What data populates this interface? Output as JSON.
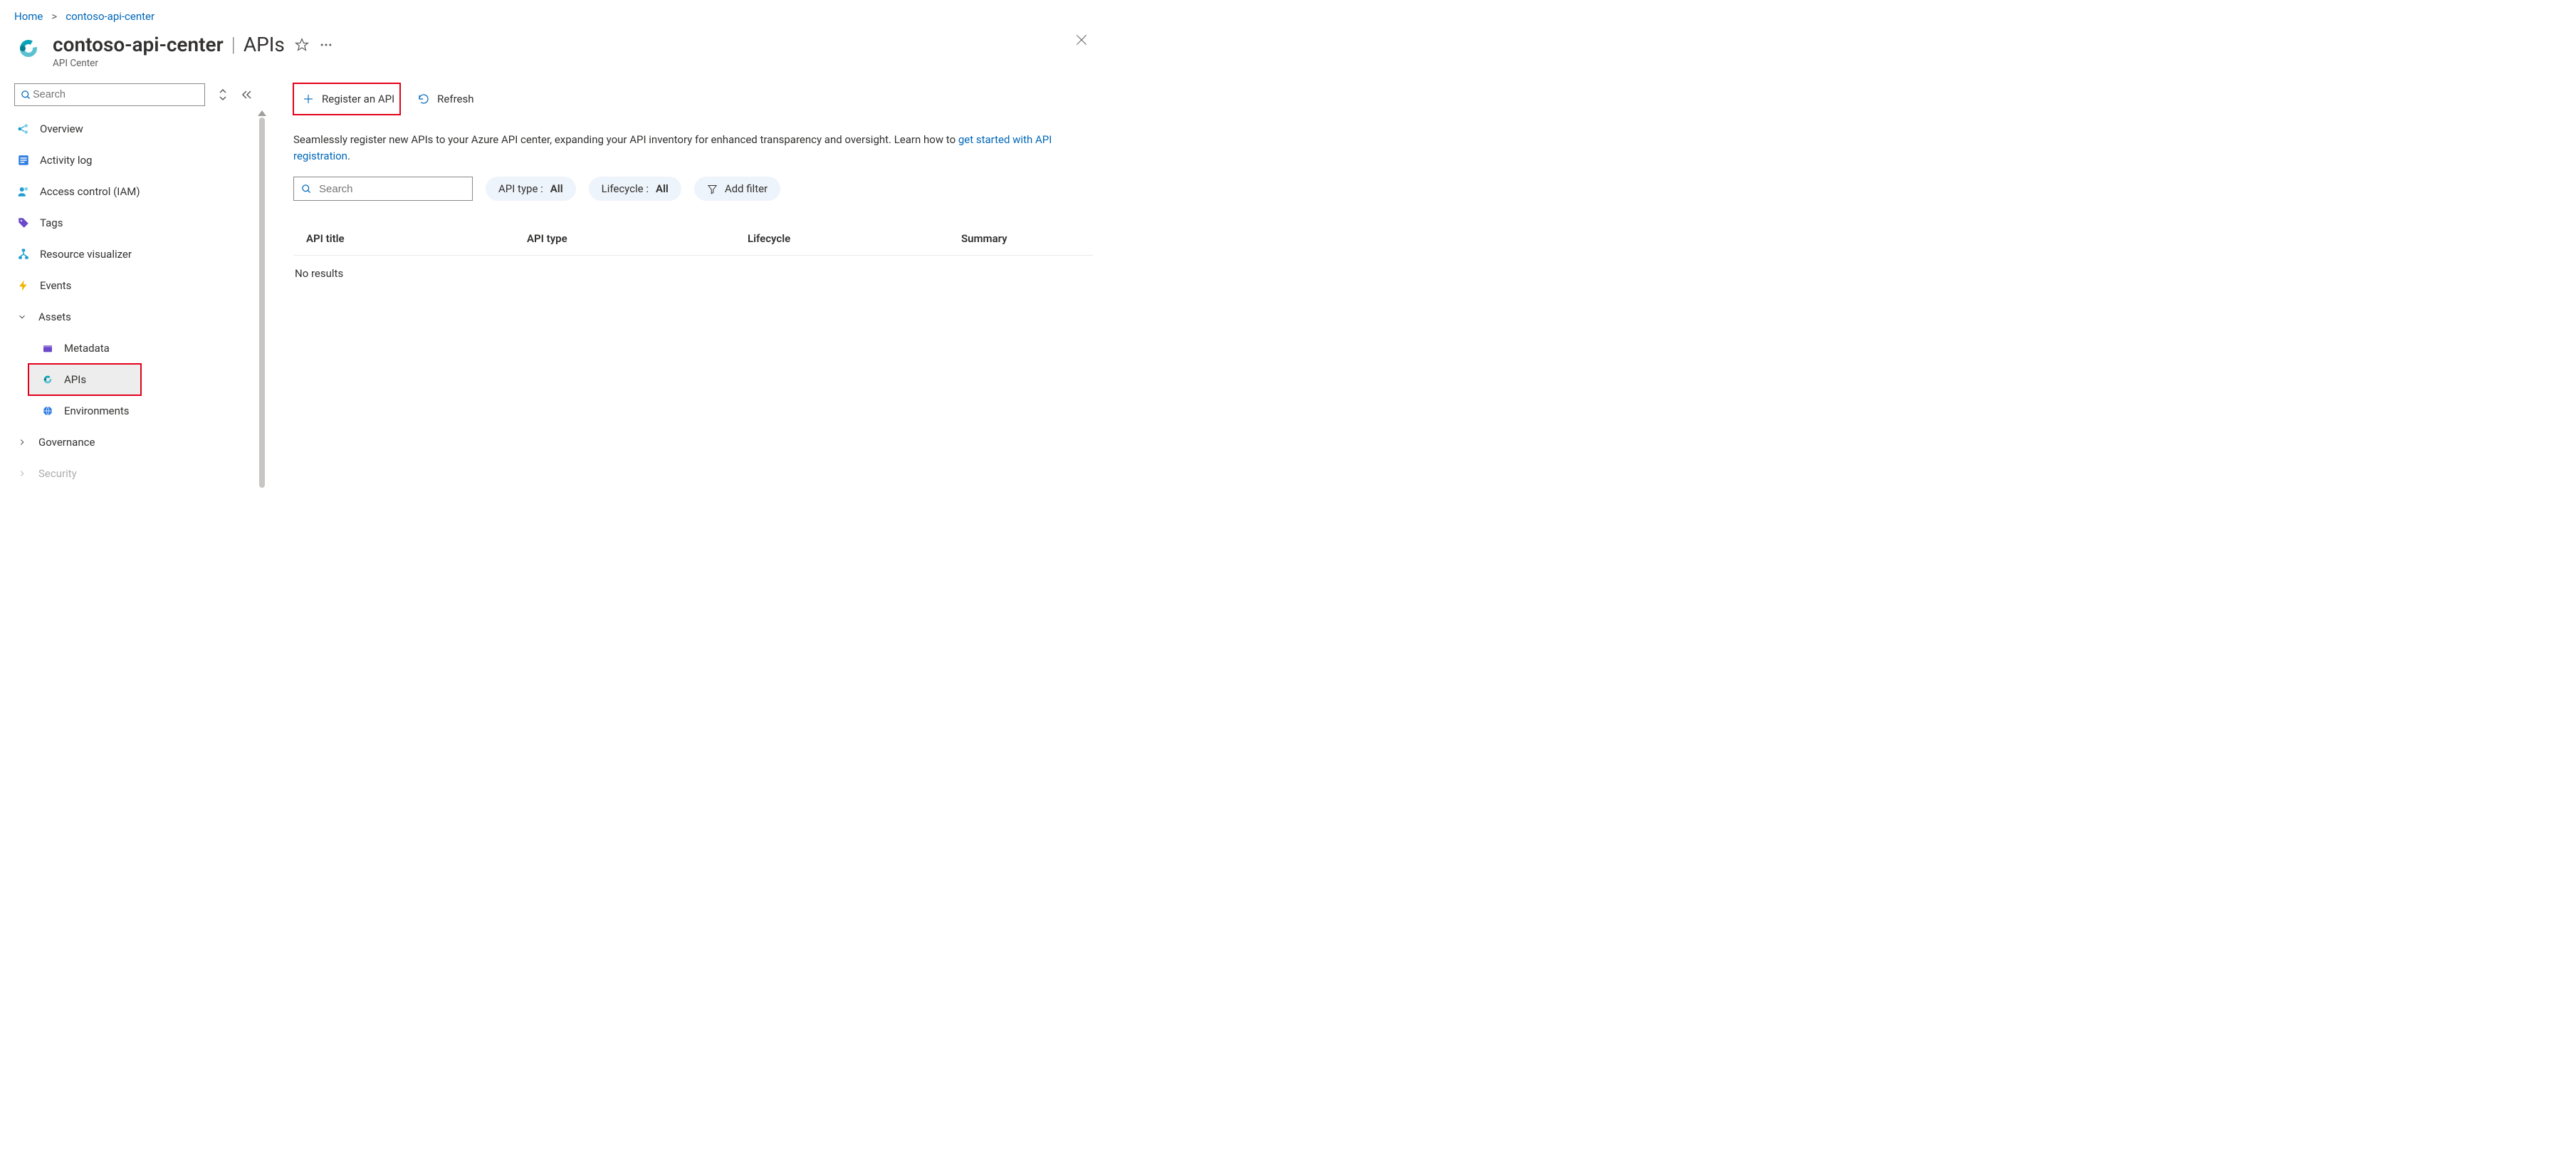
{
  "breadcrumb": {
    "home": "Home",
    "resource": "contoso-api-center"
  },
  "header": {
    "resource_name": "contoso-api-center",
    "section": "APIs",
    "subtitle": "API Center"
  },
  "sidebar": {
    "search_placeholder": "Search",
    "items": {
      "overview": "Overview",
      "activity_log": "Activity log",
      "access_control": "Access control (IAM)",
      "tags": "Tags",
      "resource_visualizer": "Resource visualizer",
      "events": "Events"
    },
    "groups": {
      "assets": "Assets",
      "governance": "Governance",
      "security": "Security"
    },
    "assets": {
      "metadata": "Metadata",
      "apis": "APIs",
      "environments": "Environments"
    }
  },
  "toolbar": {
    "register": "Register an API",
    "refresh": "Refresh"
  },
  "description": {
    "text": "Seamlessly register new APIs to your Azure API center, expanding your API inventory for enhanced transparency and oversight. Learn how to ",
    "link": "get started with API registration",
    "tail": "."
  },
  "filters": {
    "search_placeholder": "Search",
    "api_type_label": "API type : ",
    "api_type_value": "All",
    "lifecycle_label": "Lifecycle : ",
    "lifecycle_value": "All",
    "add_filter": "Add filter"
  },
  "table": {
    "columns": {
      "title": "API title",
      "type": "API type",
      "lifecycle": "Lifecycle",
      "summary": "Summary"
    },
    "empty": "No results"
  }
}
